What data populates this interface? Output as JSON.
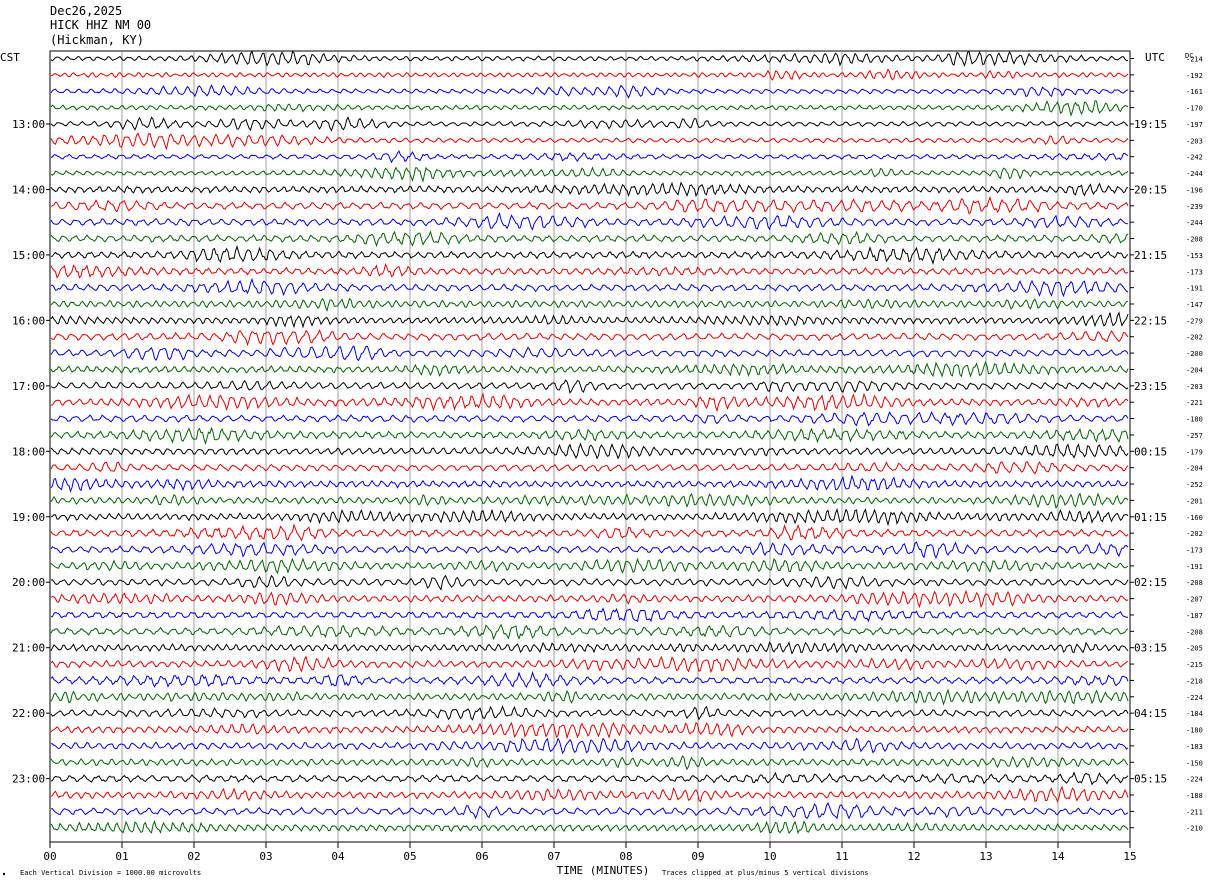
{
  "header": {
    "date": "Dec26,2025",
    "station": "HICK HHZ NM 00",
    "location": "(Hickman, KY)"
  },
  "chart_data": {
    "type": "line",
    "title": "HICK HHZ NM 00",
    "left_axis_label": "CST",
    "right_axis_label": "UTC",
    "dc_label": "DC",
    "xlabel": "TIME (MINUTES)",
    "xlim": [
      0,
      15
    ],
    "x_ticks": [
      "00",
      "01",
      "02",
      "03",
      "04",
      "05",
      "06",
      "07",
      "08",
      "09",
      "10",
      "11",
      "12",
      "13",
      "14",
      "15"
    ],
    "rows_per_hour": 4,
    "trace_colors": [
      "#000000",
      "#e00000",
      "#0000dd",
      "#006400"
    ],
    "left_hour_labels": [
      "13:00",
      "14:00",
      "15:00",
      "16:00",
      "17:00",
      "18:00",
      "19:00",
      "20:00",
      "21:00",
      "22:00",
      "23:00"
    ],
    "right_hour_labels": [
      "19:15",
      "20:15",
      "21:15",
      "22:15",
      "23:15",
      "00:15",
      "01:15",
      "02:15",
      "03:15",
      "04:15",
      "05:15"
    ],
    "dc_offsets": [
      "-214",
      "-192",
      "-161",
      "-170",
      "-197",
      "-203",
      "-242",
      "-244",
      "-196",
      "-239",
      "-244",
      "-208",
      "-153",
      "-173",
      "-191",
      "-147",
      "-279",
      "-202",
      "-200",
      "-204",
      "-203",
      "-221",
      "-180",
      "-257",
      "-179",
      "-204",
      "-252",
      "-201",
      "-160",
      "-202",
      "-173",
      "-191",
      "-208",
      "-207",
      "-187",
      "-208",
      "-205",
      "-215",
      "-218",
      "-224",
      "-184",
      "-180",
      "-183",
      "-150",
      "-224",
      "-188",
      "-211",
      "-210"
    ],
    "footer_left": "Each Vertical Division = 1000.00 microvolts",
    "footer_right": "Traces clipped at plus/minus 5 vertical divisions"
  }
}
